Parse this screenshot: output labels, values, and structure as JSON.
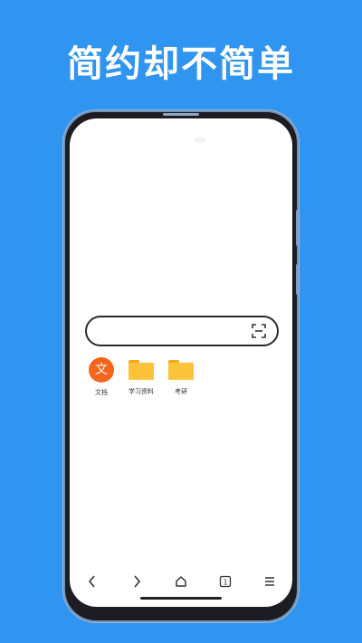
{
  "headline": "简约却不简单",
  "search": {
    "placeholder": "",
    "scan_icon": "scan-icon"
  },
  "shortcuts": [
    {
      "label": "文档",
      "icon": "document-icon",
      "glyph": "文",
      "color": "#f5651b"
    },
    {
      "label": "学习资料",
      "icon": "folder-icon",
      "color": "#fcc33a"
    },
    {
      "label": "考研",
      "icon": "folder-icon",
      "color": "#fcc33a"
    }
  ],
  "bottom_nav": {
    "tab_count": "1",
    "items": [
      "back-icon",
      "forward-icon",
      "home-icon",
      "tabs-icon",
      "menu-icon"
    ]
  },
  "colors": {
    "background": "#2f95f0",
    "accent_orange": "#f5651b",
    "folder_yellow": "#fcc33a"
  }
}
